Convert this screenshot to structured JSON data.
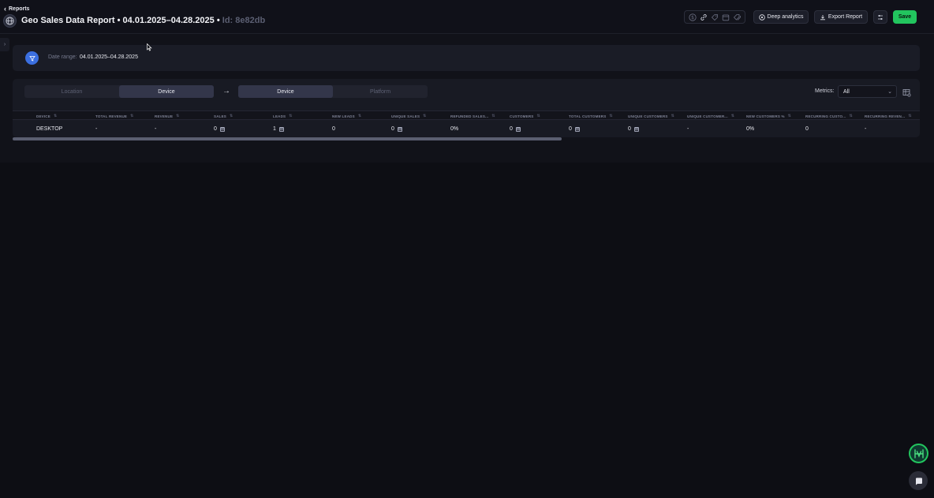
{
  "header": {
    "back_label": "Reports",
    "title_main": "Geo Sales Data Report • 04.01.2025–04.28.2025 •",
    "title_id": "Id: 8e82db",
    "buttons": {
      "deep_analytics": "Deep analytics",
      "export_report": "Export Report",
      "save": "Save"
    },
    "toolset_icons": [
      "dollar-icon",
      "link-icon",
      "tag-icon",
      "calendar-icon",
      "tags-icon"
    ]
  },
  "filters": {
    "date_label": "Date range:",
    "date_value": "04.01.2025–04.28.2025"
  },
  "grouping": {
    "left": [
      {
        "label": "Location",
        "active": false
      },
      {
        "label": "Device",
        "active": true
      }
    ],
    "right": [
      {
        "label": "Device",
        "active": true
      },
      {
        "label": "Platform",
        "active": false
      }
    ],
    "metrics_label": "Metrics:",
    "metrics_value": "All"
  },
  "table": {
    "columns": [
      "DEVICE",
      "TOTAL REVENUE",
      "REVENUE",
      "SALES",
      "LEADS",
      "NEW LEADS",
      "UNIQUE SALES",
      "REFUNDED SALES...",
      "CUSTOMERS",
      "TOTAL CUSTOMERS",
      "UNIQUE CUSTOMERS",
      "UNIQUE CUSTOMER...",
      "NEW CUSTOMERS %",
      "RECURRING CUSTO...",
      "RECURRING REVEN..."
    ],
    "rows": [
      [
        "DESKTOP",
        "-",
        "-",
        "0",
        "1",
        "0",
        "0",
        "0%",
        "0",
        "0",
        "0",
        "-",
        "0%",
        "0",
        "-"
      ]
    ]
  },
  "colors": {
    "accent_green": "#22c55e",
    "accent_blue": "#3b6fe0",
    "background": "#0d0e14"
  }
}
